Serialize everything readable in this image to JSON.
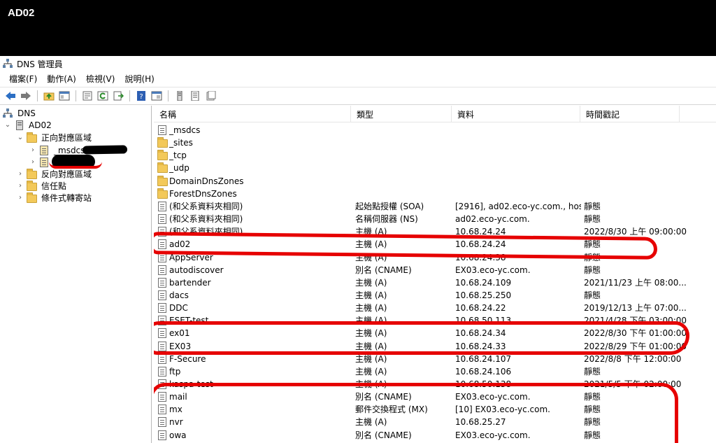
{
  "host_label": "AD02",
  "window": {
    "title": "DNS 管理員"
  },
  "menu": [
    "檔案(F)",
    "動作(A)",
    "檢視(V)",
    "說明(H)"
  ],
  "toolbar": [
    "back-icon",
    "forward-icon",
    "up-folder-icon",
    "show-tree-icon",
    "properties-icon",
    "refresh-icon",
    "export-icon",
    "help-icon",
    "view-icon",
    "server-icon",
    "list-icon",
    "record-icon"
  ],
  "tree": {
    "root": "DNS",
    "server": "AD02",
    "forward_zones": "正向對應區域",
    "msdcs": "_msdcs.",
    "reverse_zones": "反向對應區域",
    "trust_points": "信任點",
    "conditional_forwarders": "條件式轉寄站"
  },
  "columns": {
    "name": "名稱",
    "type": "類型",
    "data": "資料",
    "timestamp": "時間戳記"
  },
  "rows": [
    {
      "name": "_msdcs",
      "type": "",
      "data": "",
      "timestamp": "",
      "icon": "record"
    },
    {
      "name": "_sites",
      "type": "",
      "data": "",
      "timestamp": "",
      "icon": "folder"
    },
    {
      "name": "_tcp",
      "type": "",
      "data": "",
      "timestamp": "",
      "icon": "folder"
    },
    {
      "name": "_udp",
      "type": "",
      "data": "",
      "timestamp": "",
      "icon": "folder"
    },
    {
      "name": "DomainDnsZones",
      "type": "",
      "data": "",
      "timestamp": "",
      "icon": "folder"
    },
    {
      "name": "ForestDnsZones",
      "type": "",
      "data": "",
      "timestamp": "",
      "icon": "folder"
    },
    {
      "name": "(和父系資料夾相同)",
      "type": "起始點授權 (SOA)",
      "data": "[2916], ad02.eco-yc.com., hos...",
      "timestamp": "靜態",
      "icon": "record"
    },
    {
      "name": "(和父系資料夾相同)",
      "type": "名稱伺服器 (NS)",
      "data": "ad02.eco-yc.com.",
      "timestamp": "靜態",
      "icon": "record"
    },
    {
      "name": "(和父系資料夾相同)",
      "type": "主機 (A)",
      "data": "10.68.24.24",
      "timestamp": "2022/8/30 上午 09:00:00",
      "icon": "record"
    },
    {
      "name": "ad02",
      "type": "主機 (A)",
      "data": "10.68.24.24",
      "timestamp": "靜態",
      "icon": "record"
    },
    {
      "name": "AppServer",
      "type": "主機 (A)",
      "data": "10.68.24.38",
      "timestamp": "靜態",
      "icon": "record"
    },
    {
      "name": "autodiscover",
      "type": "別名 (CNAME)",
      "data": "EX03.eco-yc.com.",
      "timestamp": "靜態",
      "icon": "record"
    },
    {
      "name": "bartender",
      "type": "主機 (A)",
      "data": "10.68.24.109",
      "timestamp": "2021/11/23 上午 08:00...",
      "icon": "record"
    },
    {
      "name": "dacs",
      "type": "主機 (A)",
      "data": "10.68.25.250",
      "timestamp": "靜態",
      "icon": "record"
    },
    {
      "name": "DDC",
      "type": "主機 (A)",
      "data": "10.68.24.22",
      "timestamp": "2019/12/13 上午 07:00...",
      "icon": "record"
    },
    {
      "name": "ESET-test",
      "type": "主機 (A)",
      "data": "10.68.50.113",
      "timestamp": "2021/4/28 下午 03:00:00",
      "icon": "record"
    },
    {
      "name": "ex01",
      "type": "主機 (A)",
      "data": "10.68.24.34",
      "timestamp": "2022/8/30 下午 01:00:00",
      "icon": "record"
    },
    {
      "name": "EX03",
      "type": "主機 (A)",
      "data": "10.68.24.33",
      "timestamp": "2022/8/29 下午 01:00:00",
      "icon": "record"
    },
    {
      "name": "F-Secure",
      "type": "主機 (A)",
      "data": "10.68.24.107",
      "timestamp": "2022/8/8 下午 12:00:00",
      "icon": "record"
    },
    {
      "name": "ftp",
      "type": "主機 (A)",
      "data": "10.68.24.106",
      "timestamp": "靜態",
      "icon": "record"
    },
    {
      "name": "kaspa-test",
      "type": "主機 (A)",
      "data": "10.68.50.138",
      "timestamp": "2021/5/5 下午 02:00:00",
      "icon": "record"
    },
    {
      "name": "mail",
      "type": "別名 (CNAME)",
      "data": "EX03.eco-yc.com.",
      "timestamp": "靜態",
      "icon": "record"
    },
    {
      "name": "mx",
      "type": "郵件交換程式 (MX)",
      "data": "[10]  EX03.eco-yc.com.",
      "timestamp": "靜態",
      "icon": "record"
    },
    {
      "name": "nvr",
      "type": "主機 (A)",
      "data": "10.68.25.27",
      "timestamp": "靜態",
      "icon": "record"
    },
    {
      "name": "owa",
      "type": "別名 (CNAME)",
      "data": "EX03.eco-yc.com.",
      "timestamp": "靜態",
      "icon": "record"
    }
  ],
  "colors": {
    "annotation": "#e60000",
    "redaction": "#000000"
  }
}
